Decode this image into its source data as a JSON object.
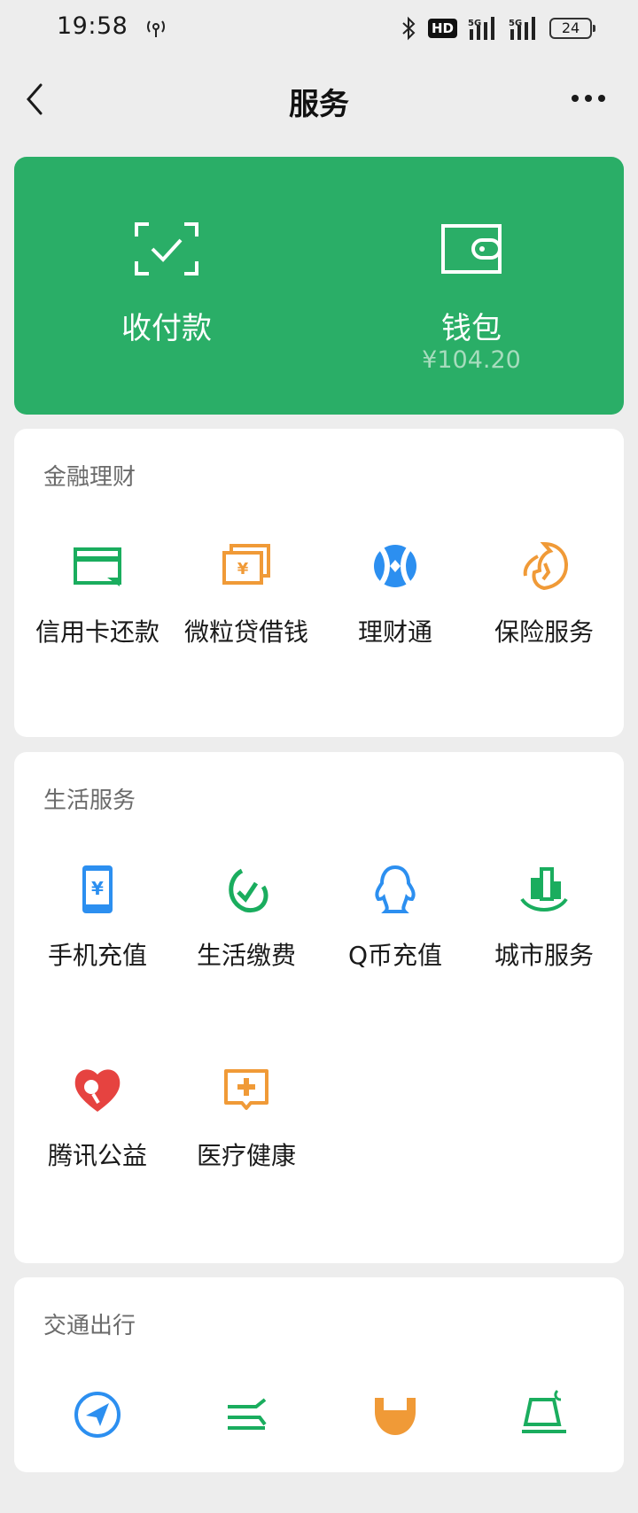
{
  "status_bar": {
    "time": "19:58",
    "hd_badge": "HD",
    "signal_1": "5G",
    "signal_2": "5G",
    "battery": "24"
  },
  "nav": {
    "title": "服务"
  },
  "top_card": {
    "pay": {
      "label": "收付款",
      "icon": "scan-pay-icon"
    },
    "wallet": {
      "label": "钱包",
      "balance": "¥104.20",
      "icon": "wallet-icon"
    }
  },
  "finance": {
    "title": "金融理财",
    "items": [
      {
        "label": "信用卡还款",
        "icon": "credit-card-icon",
        "color": "#1aad5e"
      },
      {
        "label": "微粒贷借钱",
        "icon": "loan-icon",
        "color": "#f09a37"
      },
      {
        "label": "理财通",
        "icon": "wealth-icon",
        "color": "#2c8ff0"
      },
      {
        "label": "保险服务",
        "icon": "insurance-icon",
        "color": "#f09a37"
      }
    ]
  },
  "life": {
    "title": "生活服务",
    "items": [
      {
        "label": "手机充值",
        "icon": "phone-recharge-icon",
        "color": "#2c8ff0"
      },
      {
        "label": "生活缴费",
        "icon": "utility-bill-icon",
        "color": "#1aad5e"
      },
      {
        "label": "Q币充值",
        "icon": "qq-coin-icon",
        "color": "#2c8ff0"
      },
      {
        "label": "城市服务",
        "icon": "city-service-icon",
        "color": "#1aad5e"
      },
      {
        "label": "腾讯公益",
        "icon": "charity-icon",
        "color": "#e64340"
      },
      {
        "label": "医疗健康",
        "icon": "medical-icon",
        "color": "#f09a37"
      }
    ]
  },
  "transport": {
    "title": "交通出行"
  },
  "colors": {
    "brand_green": "#2aae67",
    "background": "#ededed"
  }
}
